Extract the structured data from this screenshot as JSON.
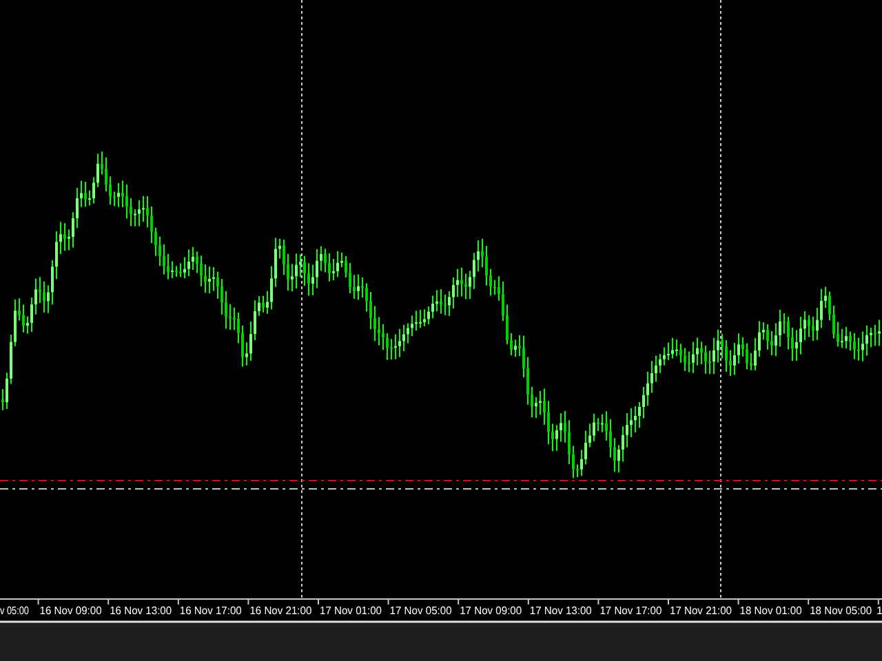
{
  "chart": {
    "x_axis_labels": [
      "v 05:00",
      "16 Nov 09:00",
      "16 Nov 13:00",
      "16 Nov 17:00",
      "16 Nov 21:00",
      "17 Nov 01:00",
      "17 Nov 05:00",
      "17 Nov 09:00",
      "17 Nov 13:00",
      "17 Nov 17:00",
      "17 Nov 21:00",
      "18 Nov 01:00",
      "18 Nov 05:00",
      "1"
    ]
  }
}
